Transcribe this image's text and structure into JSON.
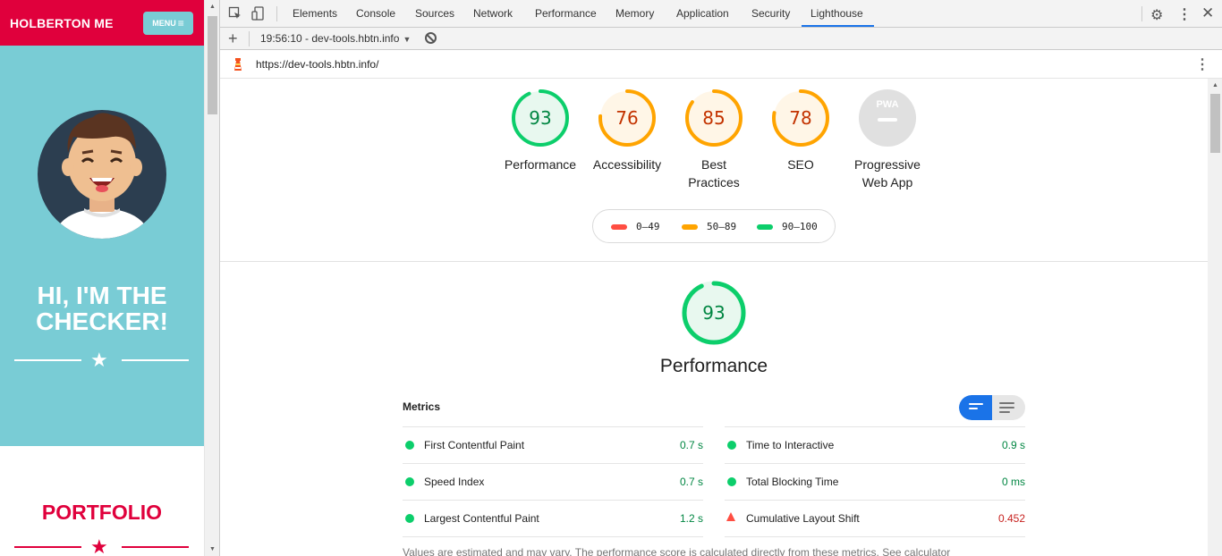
{
  "site": {
    "brand": "HOLBERTON ME",
    "menu_label": "MENU",
    "hero_title_line1": "HI, I'M THE",
    "hero_title_line2": "CHECKER!",
    "portfolio_title": "PORTFOLIO",
    "colors": {
      "brand": "#e0003c",
      "hero_bg": "#79ccd5"
    }
  },
  "devtools": {
    "tabs": [
      "Elements",
      "Console",
      "Sources",
      "Network",
      "Performance",
      "Memory",
      "Application",
      "Security",
      "Lighthouse"
    ],
    "active_tab": "Lighthouse",
    "toolbar": {
      "report_label": "19:56:10 - dev-tools.hbtn.info"
    },
    "url": "https://dev-tools.hbtn.info/"
  },
  "lighthouse": {
    "categories": [
      {
        "label_line1": "Performance",
        "label_line2": "",
        "score": "93",
        "fraction": 0.93,
        "status": "pass"
      },
      {
        "label_line1": "Accessibility",
        "label_line2": "",
        "score": "76",
        "fraction": 0.76,
        "status": "average"
      },
      {
        "label_line1": "Best",
        "label_line2": "Practices",
        "score": "85",
        "fraction": 0.85,
        "status": "average"
      },
      {
        "label_line1": "SEO",
        "label_line2": "",
        "score": "78",
        "fraction": 0.78,
        "status": "average"
      },
      {
        "label_line1": "Progressive",
        "label_line2": "Web App",
        "badge": "PWA",
        "status": "na"
      }
    ],
    "legend": [
      {
        "range": "0–49",
        "color": "#ff4e42"
      },
      {
        "range": "50–89",
        "color": "#ffa400"
      },
      {
        "range": "90–100",
        "color": "#0cce6b"
      }
    ],
    "performance": {
      "score": "93",
      "fraction": 0.93,
      "title": "Performance"
    },
    "metrics_header": "Metrics",
    "metrics_left": [
      {
        "name": "First Contentful Paint",
        "value": "0.7 s",
        "status": "pass"
      },
      {
        "name": "Speed Index",
        "value": "0.7 s",
        "status": "pass"
      },
      {
        "name": "Largest Contentful Paint",
        "value": "1.2 s",
        "status": "pass"
      }
    ],
    "metrics_right": [
      {
        "name": "Time to Interactive",
        "value": "0.9 s",
        "status": "pass"
      },
      {
        "name": "Total Blocking Time",
        "value": "0 ms",
        "status": "pass"
      },
      {
        "name": "Cumulative Layout Shift",
        "value": "0.452",
        "status": "fail"
      }
    ],
    "note_text": "Values are estimated and may vary. The performance score is calculated directly from these metrics.",
    "note_link": "See calculator",
    "colors": {
      "pass": "#0cce6b",
      "average": "#ffa400",
      "fail": "#ff4e42",
      "accent": "#1a73e8"
    }
  }
}
